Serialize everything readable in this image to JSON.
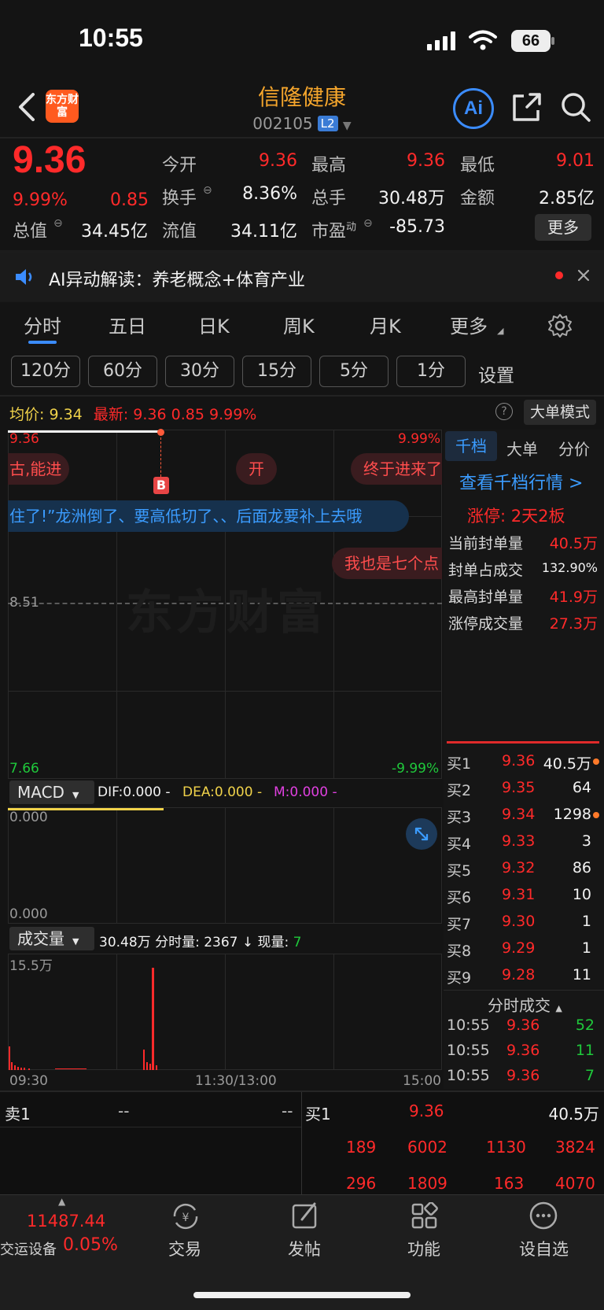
{
  "status_bar": {
    "time": "10:55",
    "battery": "66"
  },
  "header": {
    "logo_text": "东方财富",
    "stock_name": "信隆健康",
    "stock_code": "002105",
    "level_badge": "L2",
    "ai_label": "Ai"
  },
  "quote": {
    "price": "9.36",
    "change_pct": "9.99%",
    "change_amt": "0.85",
    "open_label": "今开",
    "open_val": "9.36",
    "high_label": "最高",
    "high_val": "9.36",
    "low_label": "最低",
    "low_val": "9.01",
    "turnover_label": "换手",
    "turnover_val": "8.36%",
    "volume_label": "总手",
    "volume_val": "30.48万",
    "amount_label": "金额",
    "amount_val": "2.85亿",
    "mktcap_label": "总值",
    "mktcap_val": "34.45亿",
    "float_label": "流值",
    "float_val": "34.11亿",
    "pe_label": "市盈",
    "pe_sup": "动",
    "pe_val": "-85.73",
    "more_button": "更多"
  },
  "ai_banner": {
    "text": "AI异动解读：养老概念+体育产业"
  },
  "tabs": [
    "分时",
    "五日",
    "日K",
    "周K",
    "月K",
    "更多"
  ],
  "periods": [
    "120分",
    "60分",
    "30分",
    "15分",
    "5分",
    "1分"
  ],
  "settings_label": "设置",
  "info_line": {
    "avg_label": "均价:",
    "avg_val": "9.34",
    "latest_label": "最新:",
    "latest_val": "9.36",
    "latest_chg": "0.85",
    "latest_pct": "9.99%",
    "big_order_mode": "大单模式"
  },
  "chart": {
    "y_top": "9.36",
    "y_mid": "8.51",
    "y_bottom": "7.66",
    "pct_top": "9.99%",
    "pct_bottom": "-9.99%",
    "buy_marker": "B",
    "watermark": "东方财富",
    "comments": [
      "古,能进",
      "开",
      "终于进来了",
      "住了!”龙洲倒了、要高低切了、、后面龙要补上去哦",
      "我也是七个点"
    ]
  },
  "macd": {
    "label": "MACD",
    "dif": "DIF:0.000 -",
    "dea": "DEA:0.000 -",
    "m": "M:0.000 -",
    "top": "0.000",
    "bottom": "0.000"
  },
  "volume_panel": {
    "label": "成交量",
    "summary": "30.48万 分时量: 2367 ↓ 现量:",
    "now_vol": "7",
    "y_top": "15.5万",
    "x_labels": [
      "09:30",
      "11:30/13:00",
      "15:00"
    ]
  },
  "right_panel": {
    "tabs": [
      "千档",
      "大单",
      "分价"
    ],
    "view_link": "查看千档行情 >",
    "limit_title": "涨停: 2天2板",
    "stats": [
      {
        "label": "当前封单量",
        "value": "40.5万"
      },
      {
        "label": "封单占成交",
        "value": "132.90%"
      },
      {
        "label": "最高封单量",
        "value": "41.9万"
      },
      {
        "label": "涨停成交量",
        "value": "27.3万"
      }
    ],
    "bids": [
      {
        "label": "买1",
        "price": "9.36",
        "vol": "40.5万",
        "dot": true
      },
      {
        "label": "买2",
        "price": "9.35",
        "vol": "64",
        "dot": false
      },
      {
        "label": "买3",
        "price": "9.34",
        "vol": "1298",
        "dot": true
      },
      {
        "label": "买4",
        "price": "9.33",
        "vol": "3",
        "dot": false
      },
      {
        "label": "买5",
        "price": "9.32",
        "vol": "86",
        "dot": false
      },
      {
        "label": "买6",
        "price": "9.31",
        "vol": "10",
        "dot": false
      },
      {
        "label": "买7",
        "price": "9.30",
        "vol": "1",
        "dot": false
      },
      {
        "label": "买8",
        "price": "9.29",
        "vol": "1",
        "dot": false
      },
      {
        "label": "买9",
        "price": "9.28",
        "vol": "11",
        "dot": false
      }
    ],
    "ticks_title": "分时成交",
    "ticks": [
      {
        "time": "10:55",
        "price": "9.36",
        "vol": "52"
      },
      {
        "time": "10:55",
        "price": "9.36",
        "vol": "11"
      },
      {
        "time": "10:55",
        "price": "9.36",
        "vol": "7"
      }
    ]
  },
  "bottom_book": {
    "sell1_label": "卖1",
    "sell1_price": "--",
    "sell1_vol": "--",
    "buy1_label": "买1",
    "buy1_price": "9.36",
    "buy1_vol": "40.5万",
    "queue_row1": [
      "189",
      "6002",
      "1130",
      "3824"
    ],
    "queue_row2": [
      "296",
      "1809",
      "163",
      "4070"
    ]
  },
  "bottom_bar": {
    "index_value": "11487.44",
    "index_name": "交运设备",
    "index_pct": "0.05%",
    "items": [
      "交易",
      "发帖",
      "功能",
      "设自选"
    ]
  },
  "colors": {
    "up": "#ff2a2a",
    "down": "#1fc93b",
    "accent": "#3b8cff",
    "brand": "#f4a52c"
  }
}
